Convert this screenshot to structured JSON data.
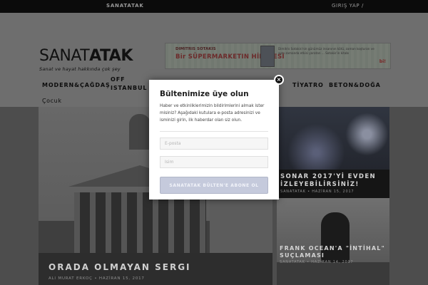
{
  "topbar": {
    "site_name": "SANATATAK",
    "login": "GIRIŞ YAP /"
  },
  "logo": {
    "part1": "SANAT",
    "part2": "ATAK",
    "tagline": "Sanat ve hayat hakkında çok şey"
  },
  "banner": {
    "small": "DIMITRIS SOTAKIS",
    "title": "Bir SÜPERMARKETIN HİKAYESİ",
    "text": "Dimitris Sotakis'nin günümüz insanının kötü, zaman koşturan ve aynı zamanda etkisi yaratan ... Sotakis'in kitabı",
    "logo": "bi!"
  },
  "nav": {
    "items": [
      {
        "label": "MODERN&ÇAĞDAŞ"
      },
      {
        "label": "OFF"
      },
      {
        "label": "ISTANBUL"
      },
      {
        "label": "TİYATRO"
      },
      {
        "label": "BETON&DOĞA"
      },
      {
        "label": "Çocuk"
      }
    ]
  },
  "featured": {
    "title": "ORADA OLMAYAN SERGI",
    "meta": "ALI MURAT ERKOÇ • HAZİRAN 15, 2017"
  },
  "side_cards": [
    {
      "title": "SONAR 2017'Yİ EVDEN İZLEYEBİLİRSİNİZ!",
      "meta": "SANATATAK • HAZİRAN 15, 2017"
    },
    {
      "title": "FRANK OCEAN'A \"İNTİHAL\" SUÇLAMASI",
      "meta": "SANATATAK • HAZİRAN 14, 2017"
    }
  ],
  "modal": {
    "title": "Bültenimize üye olun",
    "description": "Haber ve etkinliklerimizin bildirimlerini almak ister misiniz? Aşağıdaki kutulara e-posta adresinizi ve isminizi girin, ilk haberdar olan siz olun.",
    "email_placeholder": "E-posta",
    "name_placeholder": "Isim",
    "button_label": "SANATATAK BÜLTEN'E ABONE OL",
    "close_label": "×"
  }
}
